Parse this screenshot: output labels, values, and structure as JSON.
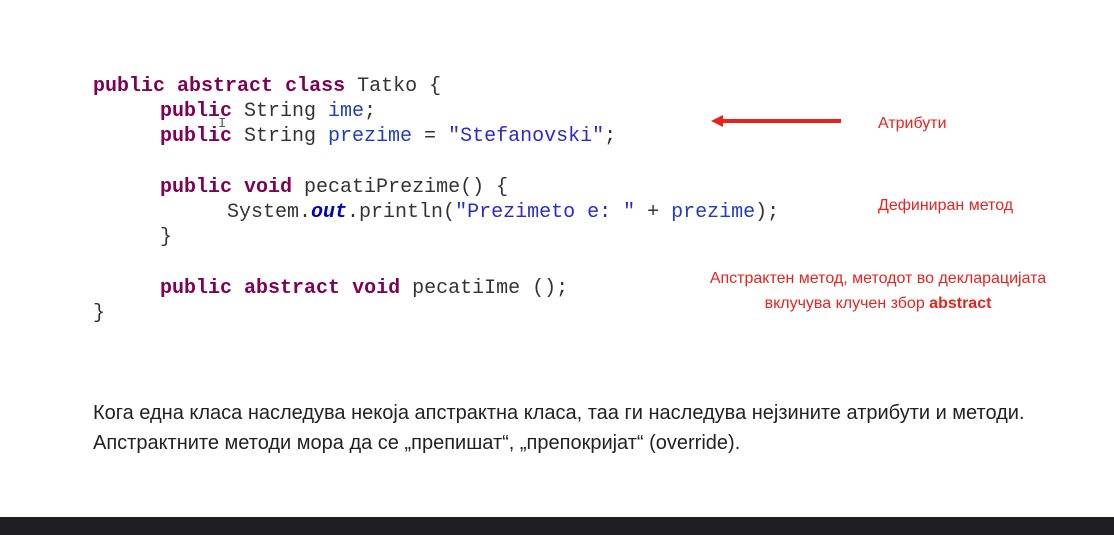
{
  "code": {
    "line1": {
      "k1": "public",
      "k2": "abstract",
      "k3": "class",
      "rest": " Tatko {"
    },
    "line2": {
      "k1": "public",
      "t": " String ",
      "f": "ime",
      "end": ";"
    },
    "line3": {
      "k1": "public",
      "t": " String ",
      "f": "prezime",
      "eq": " = ",
      "s": "\"Stefanovski\"",
      "end": ";"
    },
    "line5": {
      "k1": "public",
      "k2": "void",
      "rest": " pecatiPrezime() {"
    },
    "line6": {
      "a": "System.",
      "out": "out",
      "b": ".println(",
      "s": "\"Prezimeto e: \"",
      "c": " + ",
      "f": "prezime",
      "end": ");"
    },
    "line7": {
      "brace": "}"
    },
    "line9": {
      "k1": "public",
      "k2": "abstract",
      "k3": "void",
      "rest": " pecatiIme ();"
    },
    "line10": {
      "brace": "}"
    }
  },
  "annotations": {
    "attributes": "Атрибути",
    "defined_method": "Дефиниран метод",
    "abstract_method_1": "Апстрактен метод, методот во декларацијата",
    "abstract_method_2": "вклучува клучен збор ",
    "abstract_keyword": "abstract"
  },
  "paragraph": {
    "text": "Кога една класа наследува некоја апстрактна класа, таа ги наследува нејзините атрибути и методи. Апстрактните методи мора да се „препишат“, „препокријат“ (override)."
  },
  "colors": {
    "keyword": "#7f0055",
    "field": "#1f3fbf",
    "annotation": "#e8231e",
    "footer": "#1f1f21"
  }
}
